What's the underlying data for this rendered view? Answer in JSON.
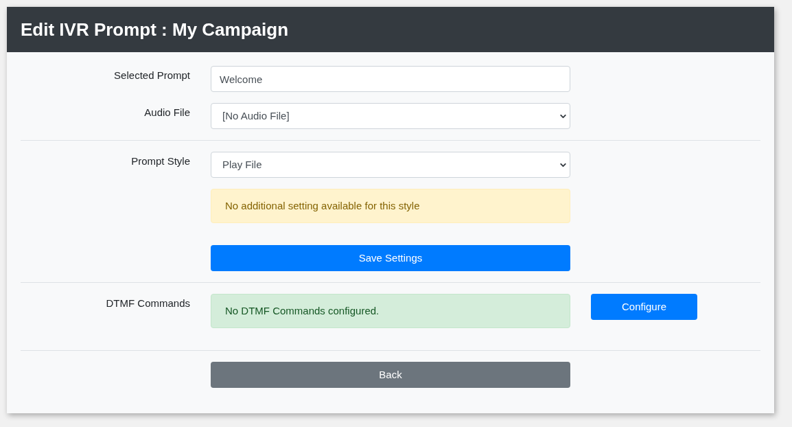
{
  "title": "Edit IVR Prompt : My Campaign",
  "selected_prompt": {
    "label": "Selected Prompt",
    "value": "Welcome"
  },
  "audio_file": {
    "label": "Audio File",
    "value": "[No Audio File]"
  },
  "prompt_style": {
    "label": "Prompt Style",
    "value": "Play File",
    "notice": "No additional setting available for this style"
  },
  "save_button": "Save Settings",
  "dtmf": {
    "label": "DTMF Commands",
    "notice": "No DTMF Commands configured.",
    "button": "Configure"
  },
  "back_button": "Back"
}
